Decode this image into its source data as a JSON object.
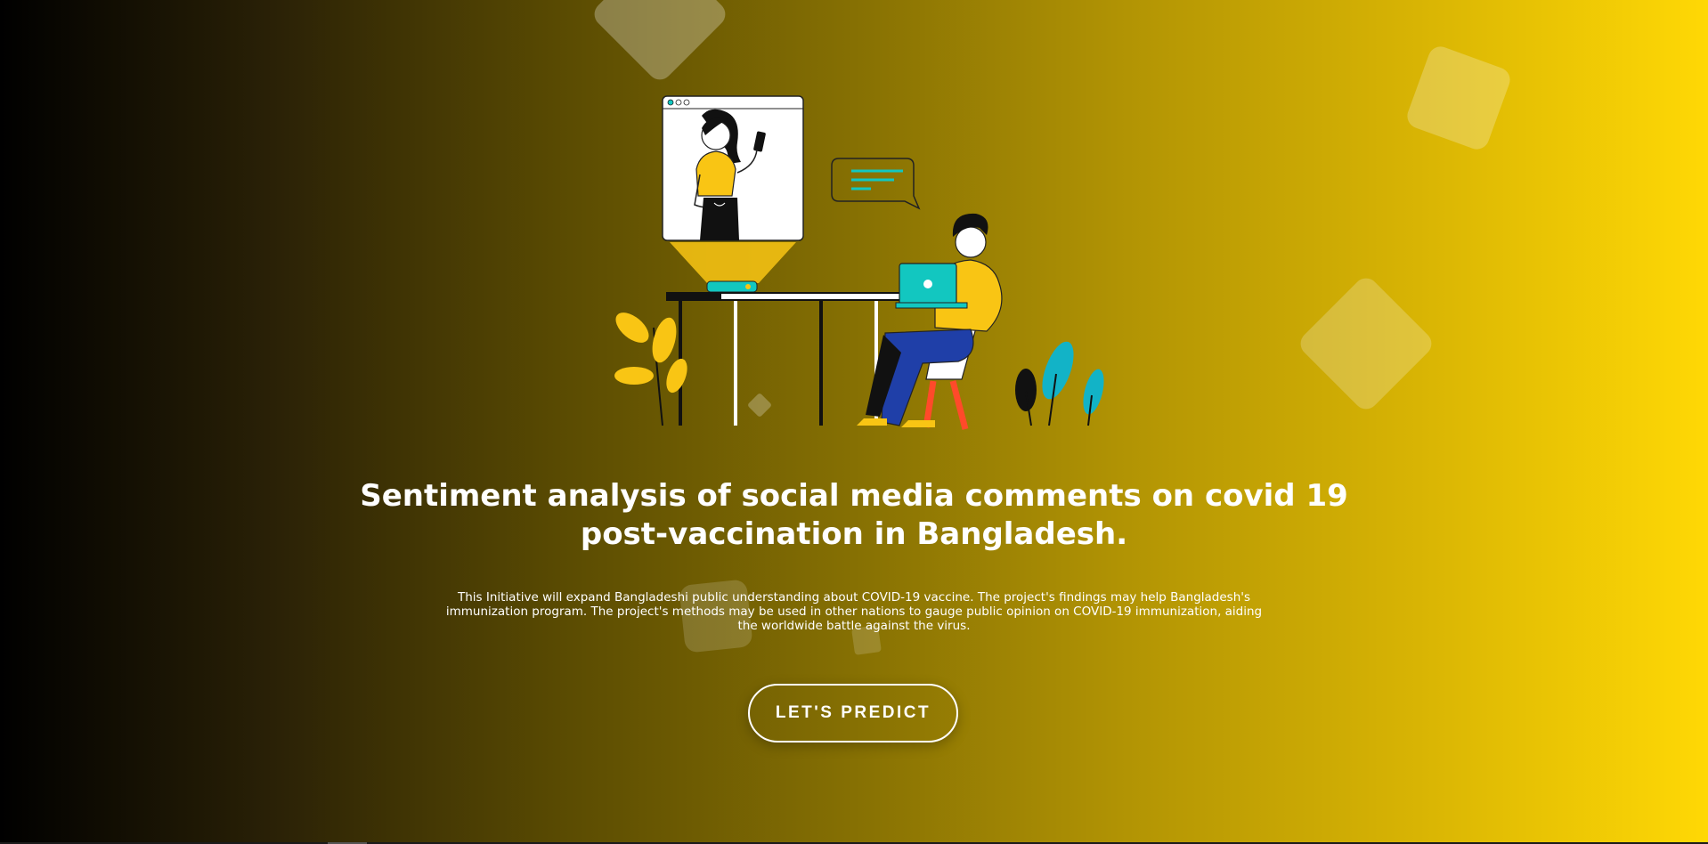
{
  "hero": {
    "title_line1": "Sentiment analysis of social media comments on covid 19",
    "title_line2": "post-vaccination in Bangladesh.",
    "description_line1": "This Initiative will expand Bangladeshi public understanding about COVID-19 vaccine. The project's findings may help Bangladesh's",
    "description_line2": "immunization program. The project's methods may be used in other nations to gauge public opinion on COVID-19 immunization, aiding",
    "description_line3": "the worldwide battle against the virus.",
    "cta_label": "LET'S PREDICT"
  },
  "illustration": {
    "icon": "video-call-illustration",
    "accent_yellow": "#f9c514",
    "accent_teal": "#12c7c0",
    "jeans_blue": "#1f3fa8",
    "chair_red": "#ff4a2a"
  },
  "theme": {
    "gradient_start": "#000000",
    "gradient_end": "#ffd805",
    "text_color": "#ffffff"
  }
}
